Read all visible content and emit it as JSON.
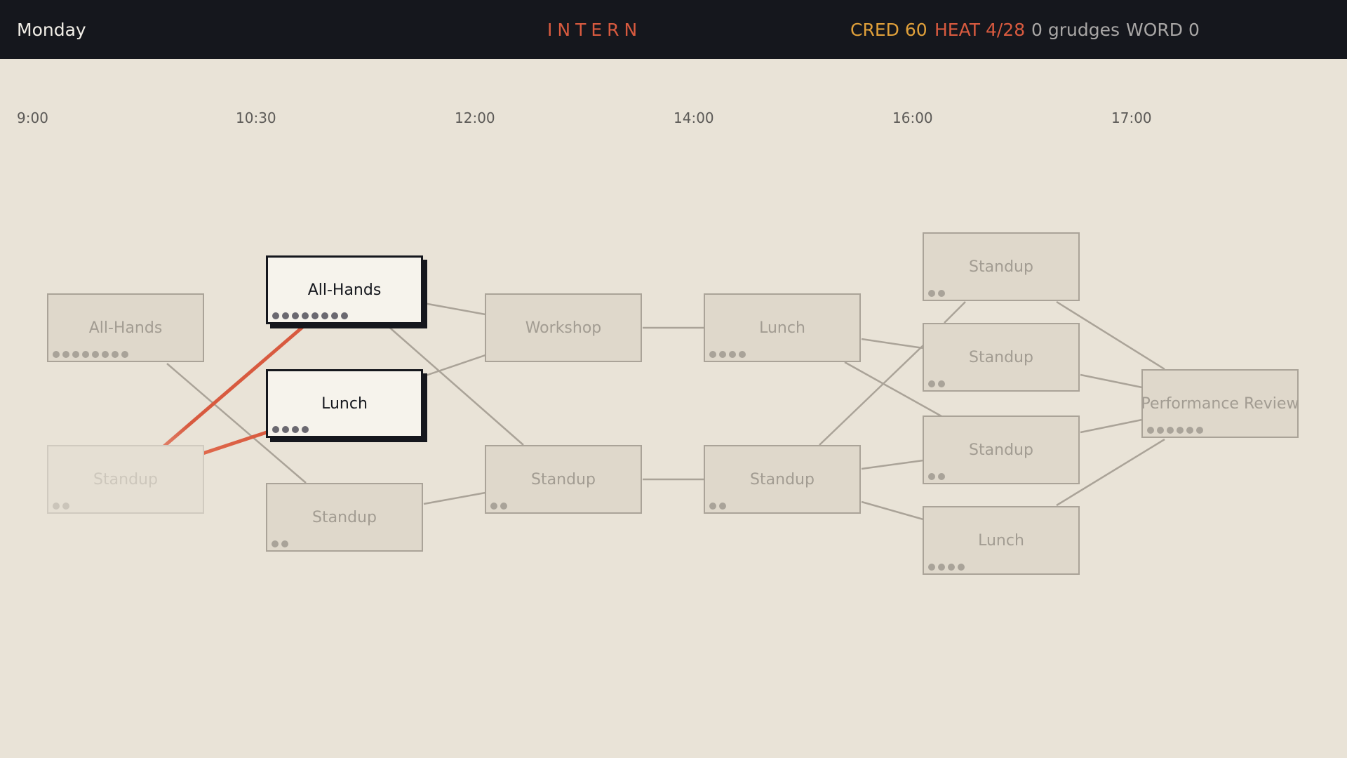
{
  "header": {
    "day": "Monday",
    "title": "INTERN",
    "cred": "CRED 60",
    "heat": "HEAT 4/28",
    "grudges": "0 grudges",
    "word": "WORD 0"
  },
  "times": [
    "9:00",
    "10:30",
    "12:00",
    "14:00",
    "16:00",
    "17:00"
  ],
  "nodes": [
    {
      "id": "n1",
      "label": "All-Hands",
      "dots": 8,
      "state": "normal"
    },
    {
      "id": "n2",
      "label": "Standup",
      "dots": 2,
      "state": "current"
    },
    {
      "id": "n3",
      "label": "All-Hands",
      "dots": 8,
      "state": "selectable"
    },
    {
      "id": "n4",
      "label": "Lunch",
      "dots": 4,
      "state": "selectable"
    },
    {
      "id": "n5",
      "label": "Standup",
      "dots": 2,
      "state": "normal"
    },
    {
      "id": "n6",
      "label": "Workshop",
      "dots": 0,
      "state": "normal"
    },
    {
      "id": "n7",
      "label": "Standup",
      "dots": 2,
      "state": "normal"
    },
    {
      "id": "n8",
      "label": "Lunch",
      "dots": 4,
      "state": "normal"
    },
    {
      "id": "n9",
      "label": "Standup",
      "dots": 2,
      "state": "normal"
    },
    {
      "id": "n10",
      "label": "Standup",
      "dots": 2,
      "state": "normal"
    },
    {
      "id": "n11",
      "label": "Standup",
      "dots": 2,
      "state": "normal"
    },
    {
      "id": "n12",
      "label": "Standup",
      "dots": 2,
      "state": "normal"
    },
    {
      "id": "n13",
      "label": "Lunch",
      "dots": 4,
      "state": "normal"
    },
    {
      "id": "n14",
      "label": "Performance Review",
      "dots": 6,
      "state": "normal"
    }
  ],
  "colors": {
    "background": "#e9e3d7",
    "topbar": "#15171d",
    "accent": "#d85a3f",
    "cred": "#e0a03a",
    "edge": "#aaa398"
  }
}
